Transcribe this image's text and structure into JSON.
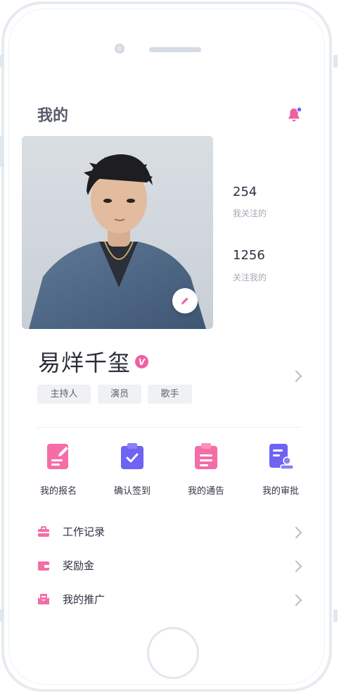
{
  "page": {
    "title": "我的"
  },
  "colors": {
    "accent_pink": "#ef5fa2",
    "accent_purple": "#6e63f2",
    "text_dark": "#2b2d38",
    "text_muted": "#a5a9b5",
    "tag_bg": "#eff1f5"
  },
  "icons": {
    "notification": "bell-icon",
    "edit": "pencil-icon",
    "verified": "v-badge-icon",
    "chevron": "chevron-right-icon"
  },
  "profile": {
    "name": "易烊千玺",
    "verified_badge": "V",
    "tags": [
      "主持人",
      "演员",
      "歌手"
    ]
  },
  "stats": [
    {
      "value": "254",
      "label": "我关注的"
    },
    {
      "value": "1256",
      "label": "关注我的"
    }
  ],
  "actions": [
    {
      "label": "我的报名",
      "icon": "signup-doc-icon"
    },
    {
      "label": "确认签到",
      "icon": "checkin-clipboard-icon"
    },
    {
      "label": "我的通告",
      "icon": "notice-clipboard-icon"
    },
    {
      "label": "我的审批",
      "icon": "approval-doc-icon"
    }
  ],
  "menu": [
    {
      "label": "工作记录",
      "icon": "briefcase-icon"
    },
    {
      "label": "奖励金",
      "icon": "wallet-icon"
    },
    {
      "label": "我的推广",
      "icon": "promotion-icon"
    }
  ]
}
